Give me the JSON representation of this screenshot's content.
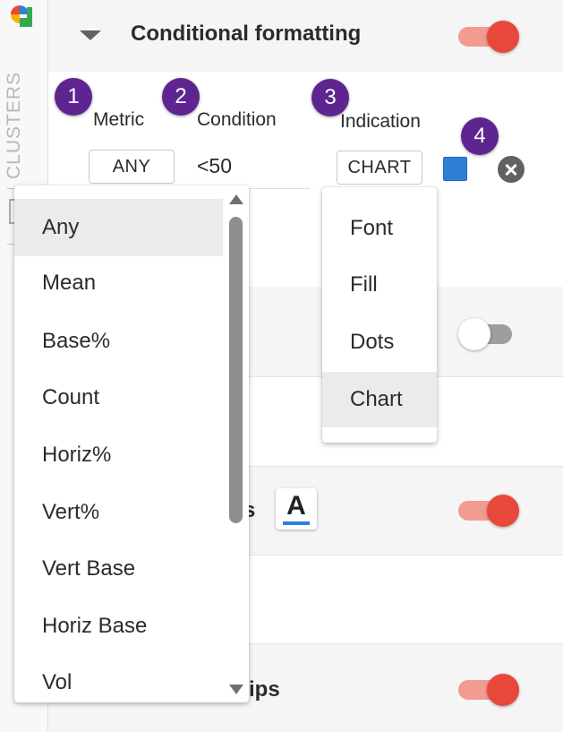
{
  "sidebar": {
    "vertical_label": "CLUSTERS",
    "logo_colors": [
      "#e8483a",
      "#2f7ed8",
      "#f5b300",
      "#34a853"
    ]
  },
  "section": {
    "title": "Conditional formatting",
    "enabled": true
  },
  "steps": [
    "1",
    "2",
    "3",
    "4"
  ],
  "columns": {
    "metric": "Metric",
    "condition": "Condition",
    "indication": "Indication"
  },
  "rule": {
    "metric": "ANY",
    "condition": "<50",
    "indication": "CHART",
    "color": "#2f7ed8"
  },
  "metric_menu": {
    "options": [
      "Any",
      "Mean",
      "Base%",
      "Count",
      "Horiz%",
      "Vert%",
      "Vert Base",
      "Horiz Base",
      "Vol"
    ],
    "selected": "Any"
  },
  "indication_menu": {
    "options": [
      "Font",
      "Fill",
      "Dots",
      "Chart"
    ],
    "selected": "Chart"
  },
  "settings": [
    {
      "label_fragment": "",
      "enabled": false
    },
    {
      "label_fragment": "s",
      "enabled": true
    },
    {
      "label_fragment": "ips",
      "enabled": true
    }
  ],
  "font_button": {
    "glyph": "A",
    "underline_color": "#2f7ed8"
  }
}
